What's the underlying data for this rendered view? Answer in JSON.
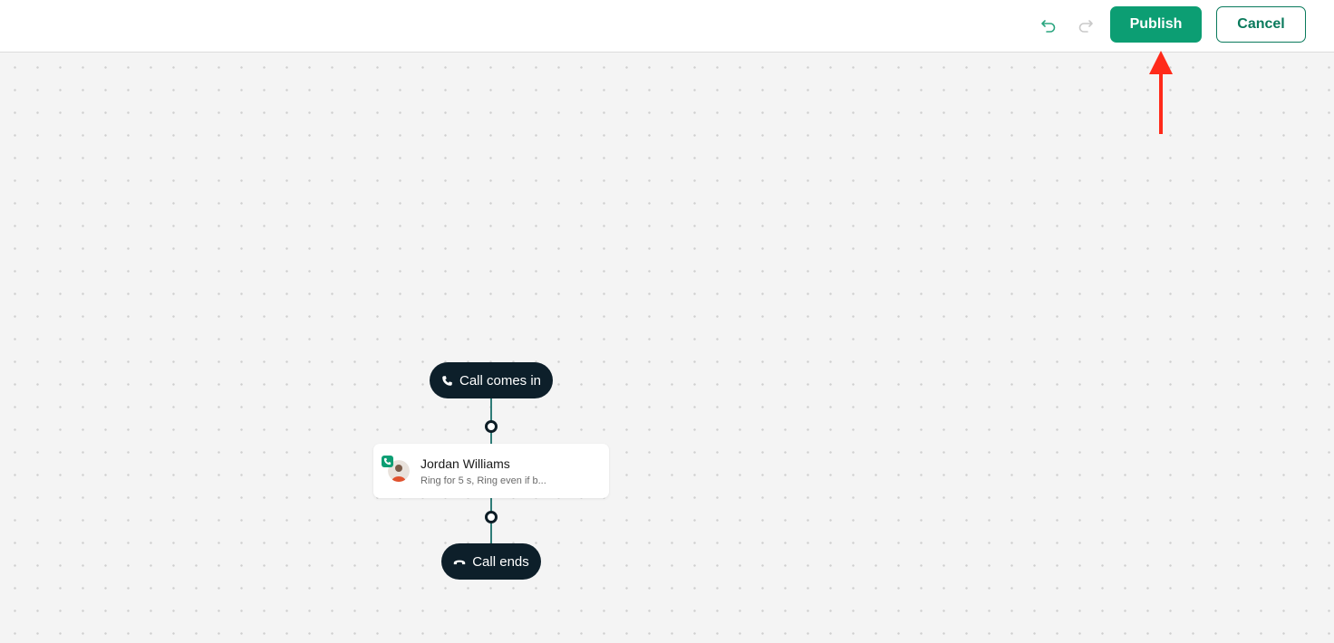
{
  "toolbar": {
    "undo_icon": "undo-icon",
    "redo_icon": "redo-icon",
    "publish_label": "Publish",
    "cancel_label": "Cancel"
  },
  "flow": {
    "start_node": {
      "label": "Call comes in",
      "icon": "phone-icon"
    },
    "step_node": {
      "title": "Jordan Williams",
      "subtitle": "Ring for 5 s, Ring even if b...",
      "icon": "avatar",
      "badge_icon": "phone-icon"
    },
    "end_node": {
      "label": "Call ends",
      "icon": "hang-up-icon"
    }
  },
  "annotation": {
    "icon": "red-arrow-icon",
    "color": "#ff2a1a"
  },
  "colors": {
    "primary": "#0c9e73",
    "node_dark": "#0d1f2a",
    "connector_line": "#2f7c78"
  }
}
